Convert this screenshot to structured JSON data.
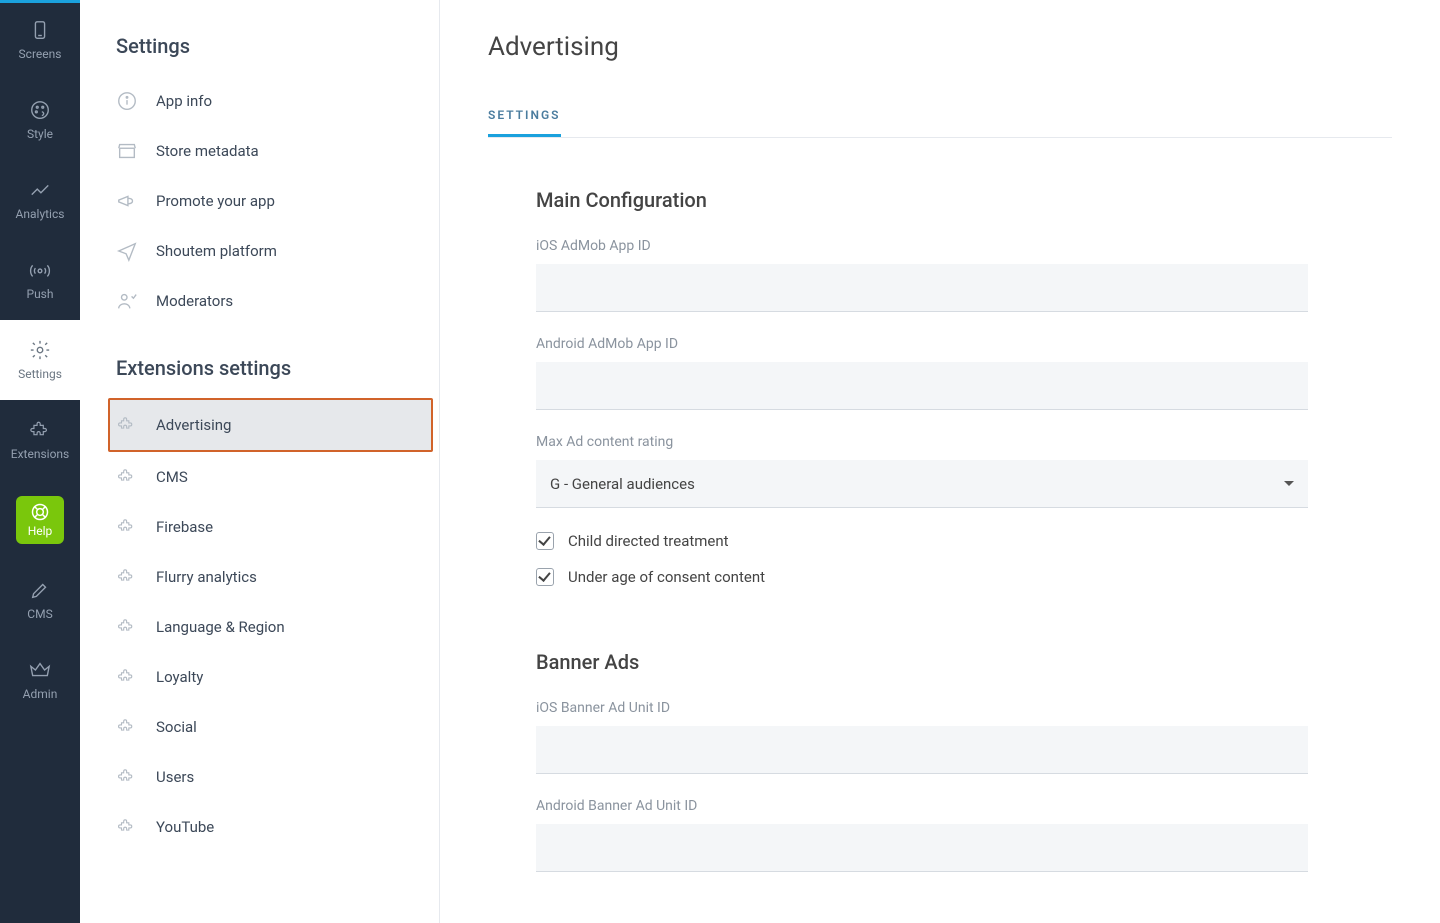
{
  "rail": {
    "items": [
      {
        "label": "Screens",
        "icon": "phone-icon",
        "state": ""
      },
      {
        "label": "Style",
        "icon": "palette-icon",
        "state": ""
      },
      {
        "label": "Analytics",
        "icon": "chart-icon",
        "state": ""
      },
      {
        "label": "Push",
        "icon": "broadcast-icon",
        "state": ""
      },
      {
        "label": "Settings",
        "icon": "gear-icon",
        "state": "selected"
      },
      {
        "label": "Extensions",
        "icon": "puzzle-icon",
        "state": ""
      },
      {
        "label": "Help",
        "icon": "lifebuoy-icon",
        "state": "help"
      },
      {
        "label": "CMS",
        "icon": "pencil-icon",
        "state": ""
      },
      {
        "label": "Admin",
        "icon": "crown-icon",
        "state": ""
      }
    ]
  },
  "side": {
    "settings_header": "Settings",
    "settings_items": [
      {
        "label": "App info",
        "icon": "info-icon"
      },
      {
        "label": "Store metadata",
        "icon": "store-icon"
      },
      {
        "label": "Promote your app",
        "icon": "megaphone-icon"
      },
      {
        "label": "Shoutem platform",
        "icon": "send-icon"
      },
      {
        "label": "Moderators",
        "icon": "moderator-icon"
      }
    ],
    "extensions_header": "Extensions settings",
    "extensions_items": [
      {
        "label": "Advertising",
        "active": true
      },
      {
        "label": "CMS",
        "active": false
      },
      {
        "label": "Firebase",
        "active": false
      },
      {
        "label": "Flurry analytics",
        "active": false
      },
      {
        "label": "Language & Region",
        "active": false
      },
      {
        "label": "Loyalty",
        "active": false
      },
      {
        "label": "Social",
        "active": false
      },
      {
        "label": "Users",
        "active": false
      },
      {
        "label": "YouTube",
        "active": false
      }
    ]
  },
  "page": {
    "title": "Advertising",
    "tab": "Settings",
    "section_main": "Main Configuration",
    "field_ios_admob": "iOS AdMob App ID",
    "field_android_admob": "Android AdMob App ID",
    "field_max_rating": "Max Ad content rating",
    "rating_value": "G - General audiences",
    "check_child": "Child directed treatment",
    "check_under_age": "Under age of consent content",
    "check_child_checked": true,
    "check_under_age_checked": true,
    "section_banner": "Banner Ads",
    "field_ios_banner": "iOS Banner Ad Unit ID",
    "field_android_banner": "Android Banner Ad Unit ID"
  }
}
